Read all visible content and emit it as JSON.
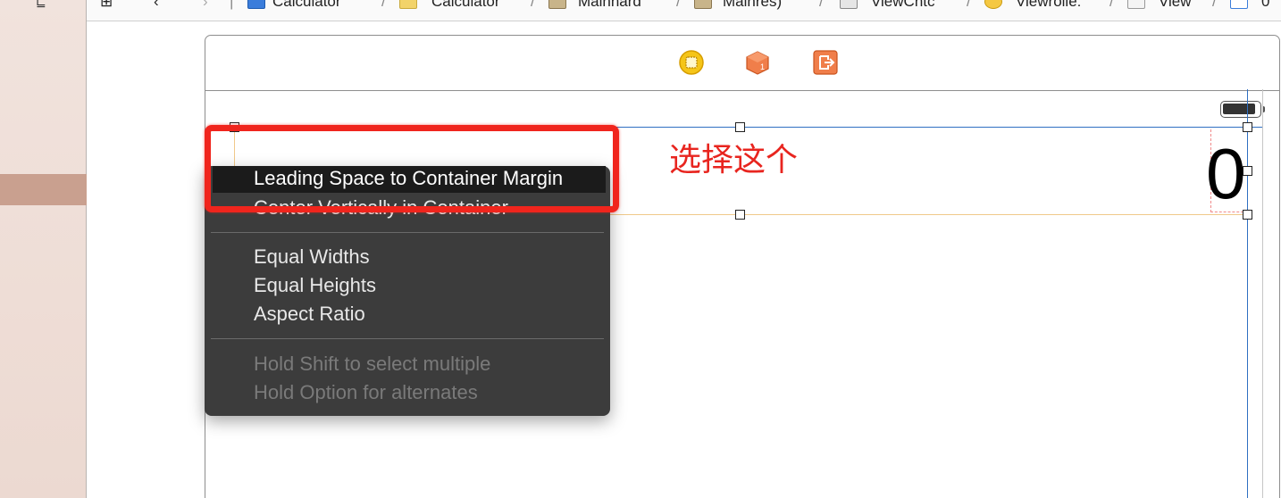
{
  "jumpbar": {
    "items": [
      {
        "label": "Calculator",
        "icon": "project-icon"
      },
      {
        "label": "Calculator",
        "icon": "folder-icon"
      },
      {
        "label": "Mainhard",
        "icon": "storyboard-icon"
      },
      {
        "label": "Mainres)",
        "icon": "storyboard-icon"
      },
      {
        "label": "ViewCntc",
        "icon": "scene-icon"
      },
      {
        "label": "Viewrolle:",
        "icon": "viewcontroller-icon"
      },
      {
        "label": "View",
        "icon": "view-icon"
      },
      {
        "label": "0",
        "icon": "label-icon"
      }
    ]
  },
  "annotation": {
    "text": "选择这个"
  },
  "canvas": {
    "label_text": "0"
  },
  "menu": {
    "items_top": [
      {
        "label": "Leading Space to Container Margin",
        "highlighted": true
      },
      {
        "label": "Center Vertically in Container",
        "highlighted": false
      }
    ],
    "items_mid": [
      "Equal Widths",
      "Equal Heights",
      "Aspect Ratio"
    ],
    "hints": [
      "Hold Shift to select multiple",
      "Hold Option for alternates"
    ]
  },
  "colors": {
    "annotation": "#e8251f",
    "menu_bg": "#3c3c3c",
    "guide": "#2f6fc2"
  }
}
